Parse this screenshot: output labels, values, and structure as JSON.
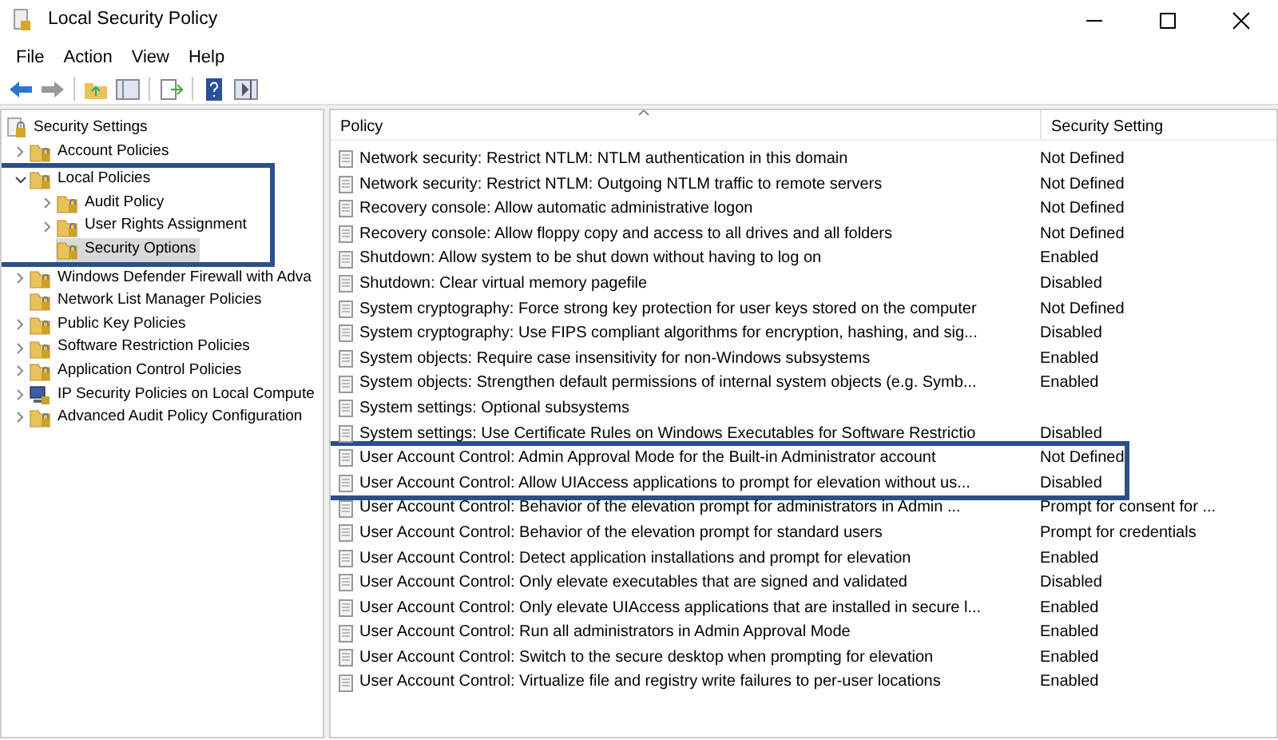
{
  "window": {
    "title": "Local Security Policy"
  },
  "menu": [
    "File",
    "Action",
    "View",
    "Help"
  ],
  "tree": {
    "label": "Security Settings",
    "kind": "root",
    "expandable": false,
    "selected": false,
    "highlighted": false,
    "children": [
      {
        "label": "Account Policies",
        "kind": "folder",
        "expandable": true,
        "expanded": false,
        "selected": false,
        "highlighted": false
      },
      {
        "label": "Local Policies",
        "kind": "folder",
        "expandable": true,
        "expanded": true,
        "selected": false,
        "highlighted": true,
        "children": [
          {
            "label": "Audit Policy",
            "kind": "folder",
            "expandable": true,
            "expanded": false,
            "selected": false,
            "highlighted": false
          },
          {
            "label": "User Rights Assignment",
            "kind": "folder",
            "expandable": true,
            "expanded": false,
            "selected": false,
            "highlighted": false
          },
          {
            "label": "Security Options",
            "kind": "folder",
            "expandable": false,
            "selected": true,
            "highlighted": false
          }
        ]
      },
      {
        "label": "Windows Defender Firewall with Adva",
        "kind": "folder",
        "expandable": true,
        "expanded": false,
        "selected": false,
        "highlighted": false
      },
      {
        "label": "Network List Manager Policies",
        "kind": "folder",
        "expandable": false,
        "selected": false,
        "highlighted": false
      },
      {
        "label": "Public Key Policies",
        "kind": "folder",
        "expandable": true,
        "expanded": false,
        "selected": false,
        "highlighted": false
      },
      {
        "label": "Software Restriction Policies",
        "kind": "folder",
        "expandable": true,
        "expanded": false,
        "selected": false,
        "highlighted": false
      },
      {
        "label": "Application Control Policies",
        "kind": "folder",
        "expandable": true,
        "expanded": false,
        "selected": false,
        "highlighted": false
      },
      {
        "label": "IP Security Policies on Local Compute",
        "kind": "computer",
        "expandable": true,
        "expanded": false,
        "selected": false,
        "highlighted": false
      },
      {
        "label": "Advanced Audit Policy Configuration",
        "kind": "folder",
        "expandable": true,
        "expanded": false,
        "selected": false,
        "highlighted": false
      }
    ]
  },
  "table": {
    "columns": [
      "Policy",
      "Security Setting"
    ],
    "rows": [
      {
        "policy": "Network security: Restrict NTLM: NTLM authentication in this domain",
        "setting": "Not Defined",
        "highlighted": false
      },
      {
        "policy": "Network security: Restrict NTLM: Outgoing NTLM traffic to remote servers",
        "setting": "Not Defined",
        "highlighted": false
      },
      {
        "policy": "Recovery console: Allow automatic administrative logon",
        "setting": "Not Defined",
        "highlighted": false
      },
      {
        "policy": "Recovery console: Allow floppy copy and access to all drives and all folders",
        "setting": "Not Defined",
        "highlighted": false
      },
      {
        "policy": "Shutdown: Allow system to be shut down without having to log on",
        "setting": "Enabled",
        "highlighted": false
      },
      {
        "policy": "Shutdown: Clear virtual memory pagefile",
        "setting": "Disabled",
        "highlighted": false
      },
      {
        "policy": "System cryptography: Force strong key protection for user keys stored on the computer",
        "setting": "Not Defined",
        "highlighted": false
      },
      {
        "policy": "System cryptography: Use FIPS compliant algorithms for encryption, hashing, and sig...",
        "setting": "Disabled",
        "highlighted": false
      },
      {
        "policy": "System objects: Require case insensitivity for non-Windows subsystems",
        "setting": "Enabled",
        "highlighted": false
      },
      {
        "policy": "System objects: Strengthen default permissions of internal system objects (e.g. Symb...",
        "setting": "Enabled",
        "highlighted": false
      },
      {
        "policy": "System settings: Optional subsystems",
        "highlighted": false
      },
      {
        "policy": "System settings: Use Certificate Rules on Windows Executables for Software Restrictio",
        "setting": "Disabled",
        "highlighted": false
      },
      {
        "policy": "User Account Control: Admin Approval Mode for the Built-in Administrator account",
        "setting": "Not Defined",
        "highlighted": true
      },
      {
        "policy": "User Account Control: Allow UIAccess applications to prompt for elevation without us...",
        "setting": "Disabled",
        "highlighted": true
      },
      {
        "policy": "User Account Control: Behavior of the elevation prompt for administrators in Admin ...",
        "setting": "Prompt for consent for ...",
        "highlighted": false
      },
      {
        "policy": "User Account Control: Behavior of the elevation prompt for standard users",
        "setting": "Prompt for credentials",
        "highlighted": false
      },
      {
        "policy": "User Account Control: Detect application installations and prompt for elevation",
        "setting": "Enabled",
        "highlighted": false
      },
      {
        "policy": "User Account Control: Only elevate executables that are signed and validated",
        "setting": "Disabled",
        "highlighted": false
      },
      {
        "policy": "User Account Control: Only elevate UIAccess applications that are installed in secure l...",
        "setting": "Enabled",
        "highlighted": false
      },
      {
        "policy": "User Account Control: Run all administrators in Admin Approval Mode",
        "setting": "Enabled",
        "highlighted": false
      },
      {
        "policy": "User Account Control: Switch to the secure desktop when prompting for elevation",
        "setting": "Enabled",
        "highlighted": false
      },
      {
        "policy": "User Account Control: Virtualize file and registry write failures to per-user locations",
        "setting": "Enabled",
        "highlighted": false
      }
    ]
  }
}
